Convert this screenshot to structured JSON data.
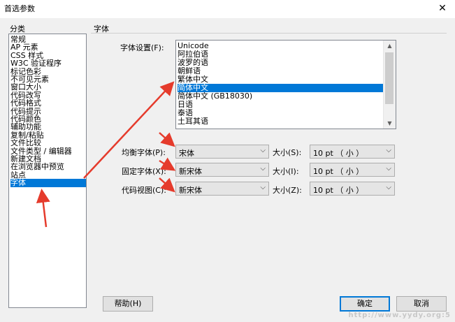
{
  "window": {
    "title": "首选参数",
    "close_glyph": "✕"
  },
  "category": {
    "header": "分类",
    "items": [
      "常规",
      "AP 元素",
      "CSS 样式",
      "W3C 验证程序",
      "标记色彩",
      "不可见元素",
      "窗口大小",
      "代码改写",
      "代码格式",
      "代码提示",
      "代码颜色",
      "辅助功能",
      "复制/粘贴",
      "文件比较",
      "文件类型 / 编辑器",
      "新建文档",
      "在浏览器中预览",
      "站点",
      "字体"
    ],
    "selected_index": 18
  },
  "section": {
    "title": "字体"
  },
  "font_settings": {
    "label": "字体设置(F):",
    "items": [
      "Unicode",
      "阿拉伯语",
      "波罗的语",
      "朝鲜语",
      "繁体中文",
      "简体中文",
      "简体中文 (GB18030)",
      "日语",
      "泰语",
      "土耳其语"
    ],
    "selected_index": 5,
    "scroll_up_glyph": "▲",
    "scroll_down_glyph": "▼"
  },
  "rows": [
    {
      "label": "均衡字体(P):",
      "font": "宋体",
      "size_label": "大小(S):",
      "size": "10 pt （ 小 ）"
    },
    {
      "label": "固定字体(X):",
      "font": "新宋体",
      "size_label": "大小(I):",
      "size": "10 pt （ 小 ）"
    },
    {
      "label": "代码视图(C):",
      "font": "新宋体",
      "size_label": "大小(Z):",
      "size": "10 pt （ 小 ）"
    }
  ],
  "dropdown_glyph": "⌵",
  "buttons": {
    "help": "帮助(H)",
    "ok": "确定",
    "cancel": "取消"
  },
  "watermark": "http://www.yydy.org:5",
  "colors": {
    "selection": "#0078d7",
    "annotation_arrow": "#e53b2c"
  }
}
